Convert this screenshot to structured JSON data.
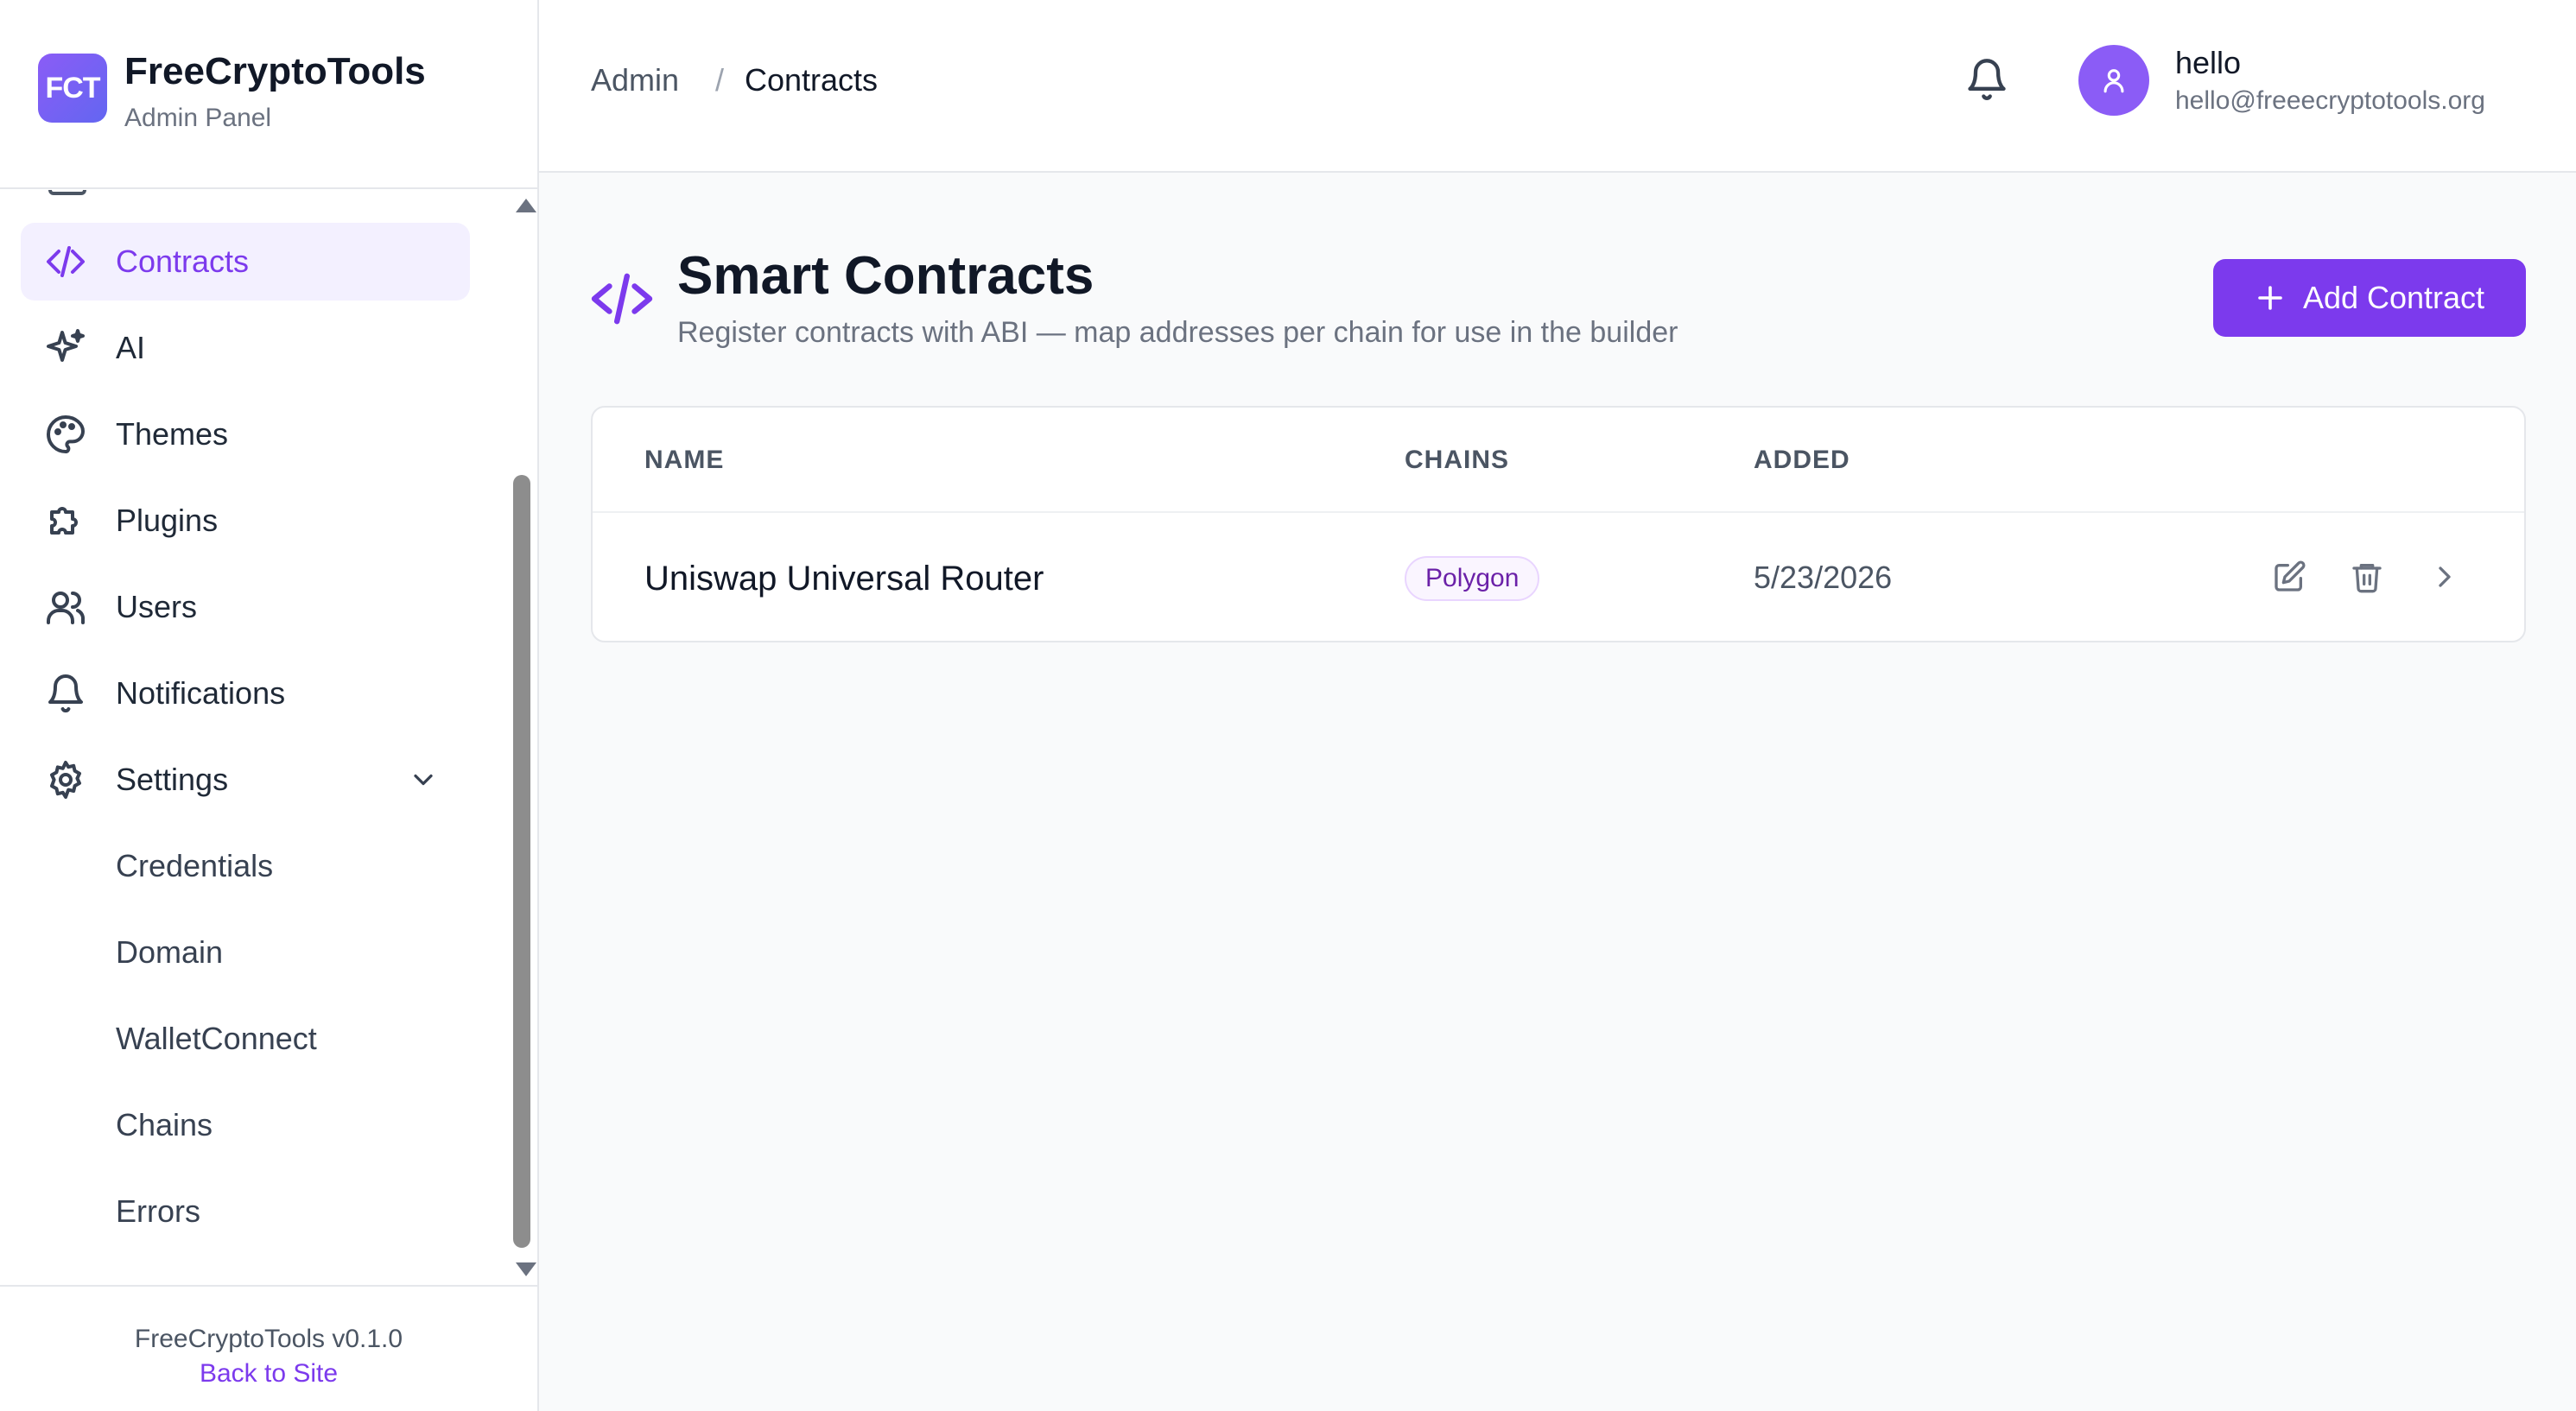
{
  "brand": {
    "logo": "FCT",
    "name": "FreeCryptoTools",
    "subtitle": "Admin Panel"
  },
  "sidebar": {
    "items": [
      {
        "label": "Contracts",
        "icon": "code-icon",
        "active": true
      },
      {
        "label": "AI",
        "icon": "sparkles-icon"
      },
      {
        "label": "Themes",
        "icon": "palette-icon"
      },
      {
        "label": "Plugins",
        "icon": "puzzle-icon"
      },
      {
        "label": "Users",
        "icon": "users-icon"
      },
      {
        "label": "Notifications",
        "icon": "bell-icon"
      },
      {
        "label": "Settings",
        "icon": "gear-icon",
        "expanded": true
      }
    ],
    "settings_children": [
      "Credentials",
      "Domain",
      "WalletConnect",
      "Chains",
      "Errors"
    ],
    "footer": {
      "version": "FreeCryptoTools v0.1.0",
      "back_link": "Back to Site"
    }
  },
  "header": {
    "breadcrumb": {
      "root": "Admin",
      "separator": "/",
      "current": "Contracts"
    },
    "user": {
      "name": "hello",
      "email": "hello@freeecryptotools.org"
    }
  },
  "main": {
    "title": "Smart Contracts",
    "subtitle": "Register contracts with ABI — map addresses per chain for use in the builder",
    "add_button": "Add Contract",
    "table": {
      "columns": [
        "NAME",
        "CHAINS",
        "ADDED"
      ],
      "rows": [
        {
          "name": "Uniswap Universal Router",
          "chains": [
            "Polygon"
          ],
          "added": "5/23/2026"
        }
      ]
    }
  },
  "colors": {
    "accent": "#7c3aed",
    "badge_bg": "#faf5ff",
    "badge_border": "#e9d5ff"
  }
}
